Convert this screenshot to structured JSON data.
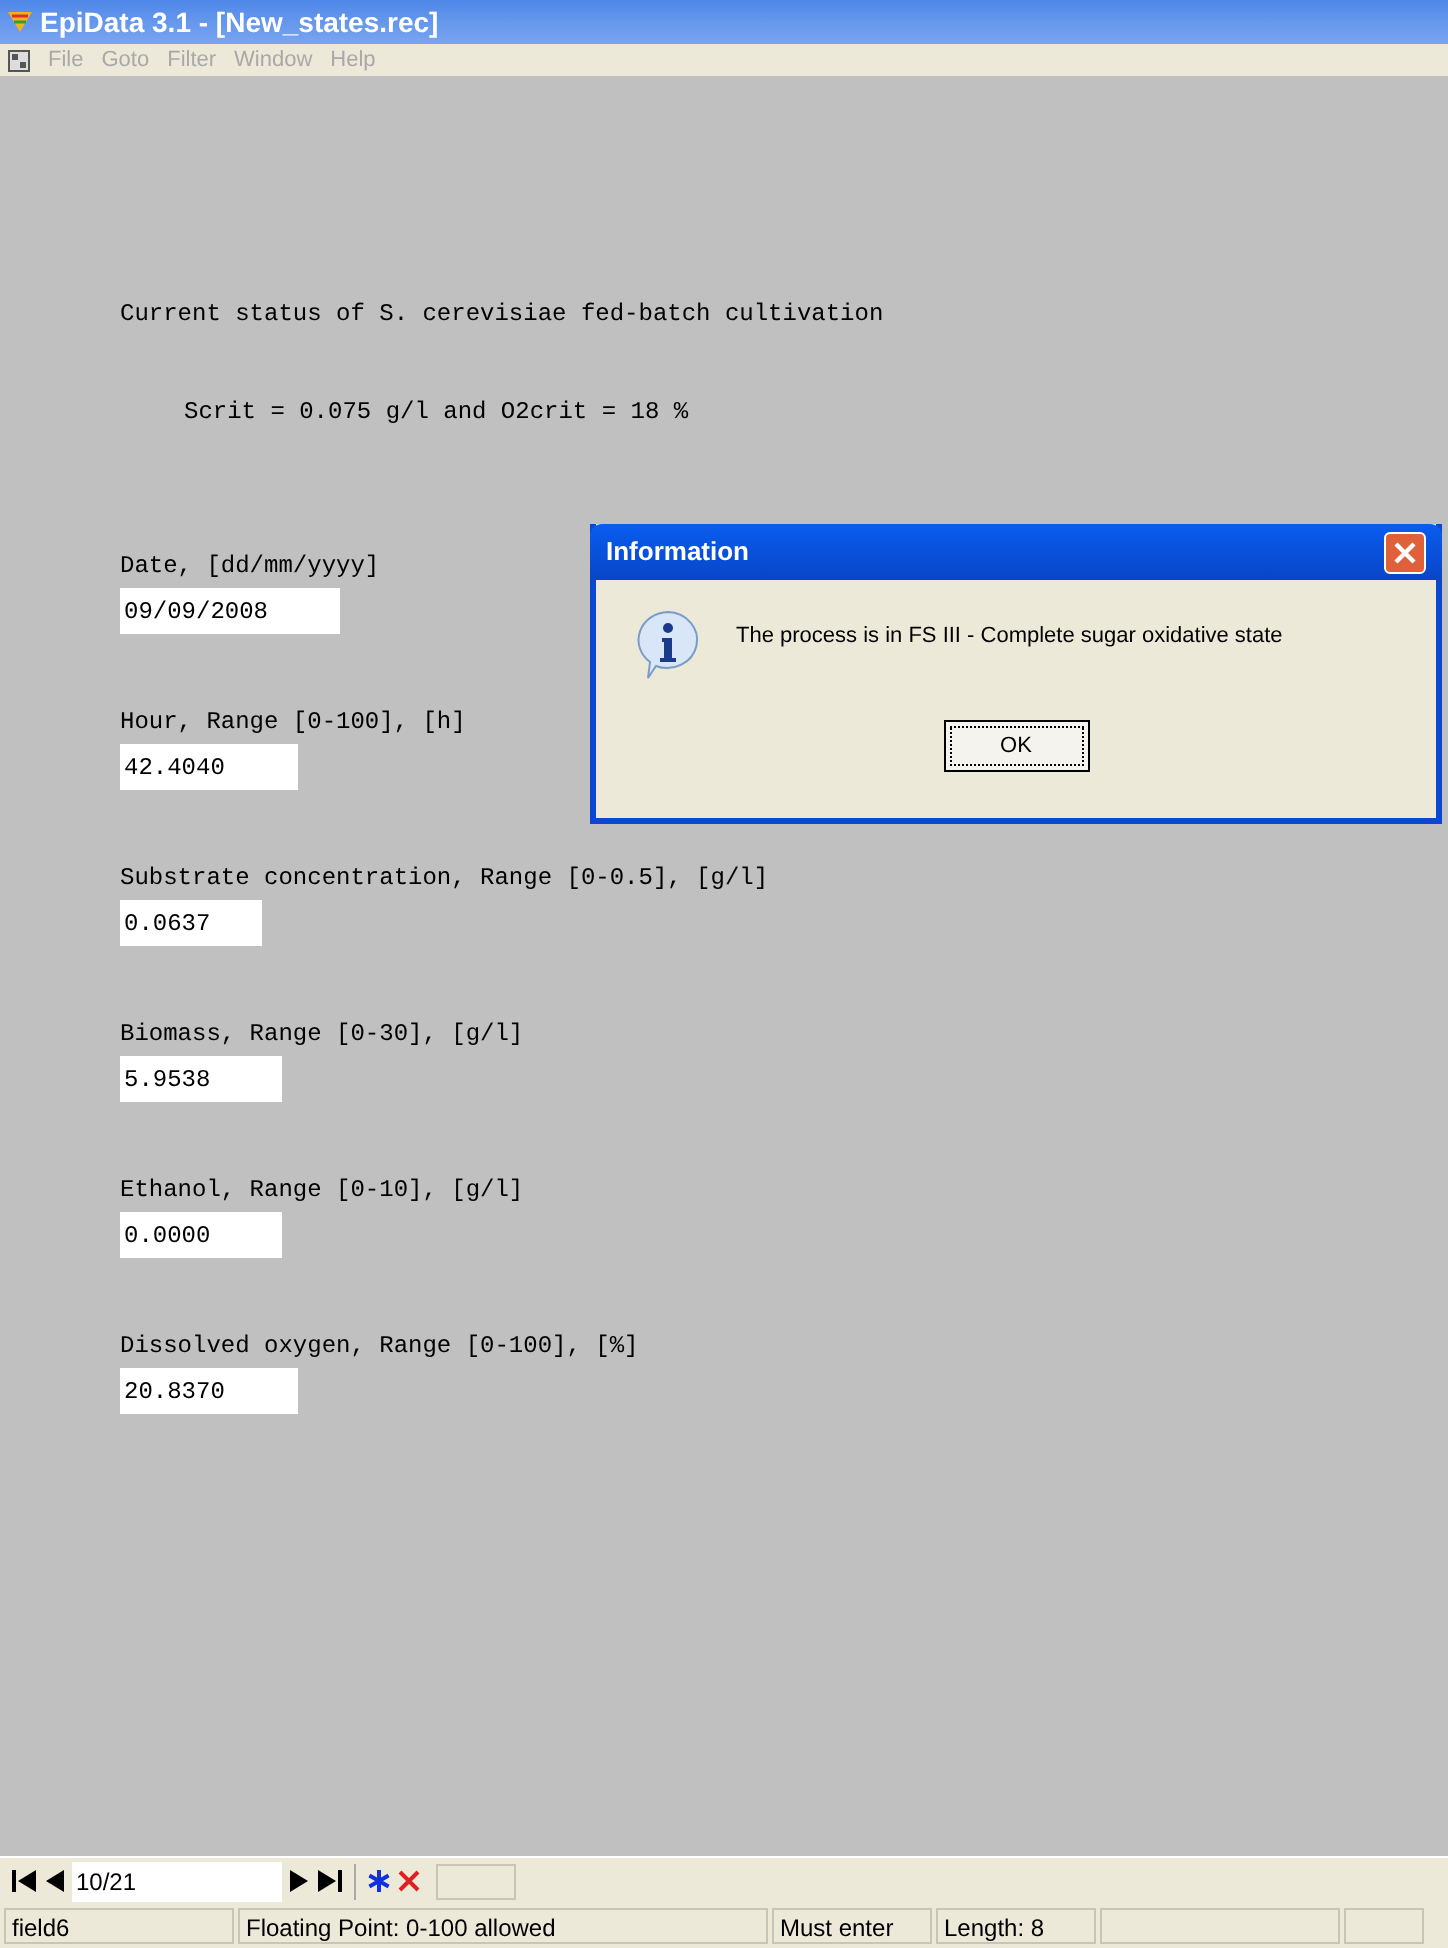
{
  "window": {
    "title": "EpiData 3.1 - [New_states.rec]"
  },
  "menu": [
    {
      "label": "File",
      "disabled": true
    },
    {
      "label": "Goto",
      "disabled": true
    },
    {
      "label": "Filter",
      "disabled": true
    },
    {
      "label": "Window",
      "disabled": true
    },
    {
      "label": "Help",
      "disabled": true
    }
  ],
  "form": {
    "heading": "Current status of S. cerevisiae fed-batch cultivation",
    "subheading": "Scrit = 0.075 g/l and O2crit = 18 %",
    "fields": [
      {
        "label": "Date, [dd/mm/yyyy]",
        "value": "09/09/2008"
      },
      {
        "label": "Hour, Range [0-100], [h]",
        "value": "42.4040"
      },
      {
        "label": "Substrate concentration, Range [0-0.5], [g/l]",
        "value": "0.0637"
      },
      {
        "label": "Biomass, Range [0-30], [g/l]",
        "value": "5.9538"
      },
      {
        "label": "Ethanol, Range [0-10], [g/l]",
        "value": "0.0000"
      },
      {
        "label": "Dissolved oxygen, Range [0-100], [%]",
        "value": "20.8370"
      }
    ]
  },
  "dialog": {
    "title": "Information",
    "message": "The process is in FS III - Complete sugar oxidative state",
    "button": "OK"
  },
  "navigator": {
    "record": "10/21"
  },
  "status_bar": [
    "field6",
    "Floating Point: 0-100 allowed",
    "Must enter",
    "Length: 8"
  ]
}
